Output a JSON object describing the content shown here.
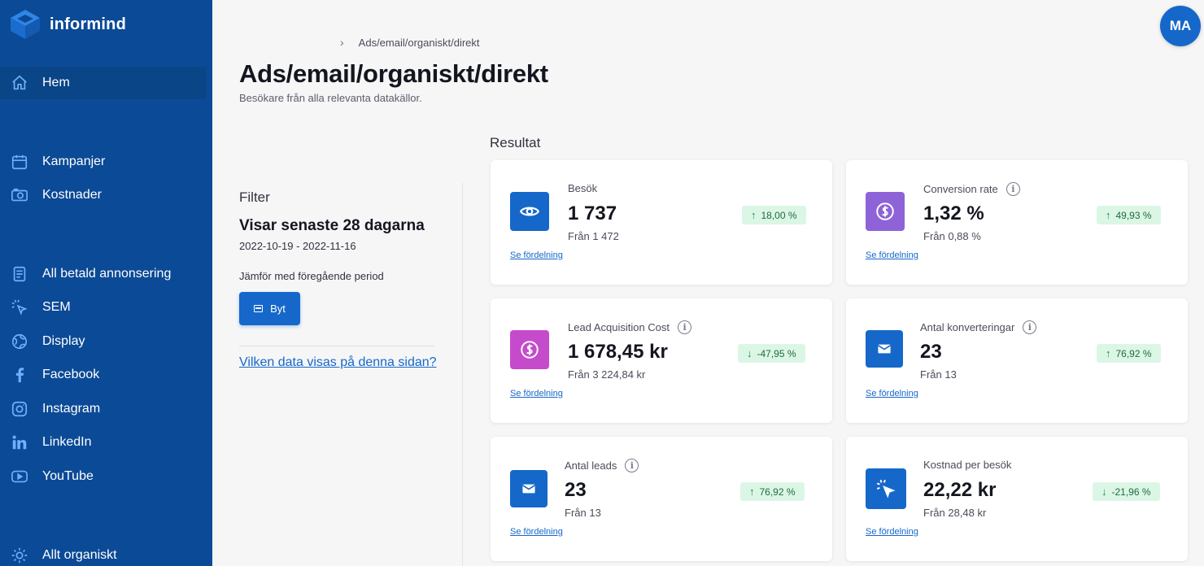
{
  "brand": {
    "name": "informind"
  },
  "colors": {
    "sidebar": "#0b4a96",
    "accent": "#1568c9",
    "badge_bg": "#dcf6e6",
    "badge_text": "#1e6b3e"
  },
  "sidebar": {
    "items": [
      {
        "label": "Hem",
        "icon": "home-icon",
        "active": true
      },
      {
        "label": "Kampanjer",
        "icon": "calendar-icon"
      },
      {
        "label": "Kostnader",
        "icon": "camera-icon"
      },
      {
        "label": "All betald annonsering",
        "icon": "document-icon"
      },
      {
        "label": "SEM",
        "icon": "cursor-click-icon"
      },
      {
        "label": "Display",
        "icon": "globe-icon"
      },
      {
        "label": "Facebook",
        "icon": "facebook-icon"
      },
      {
        "label": "Instagram",
        "icon": "instagram-icon"
      },
      {
        "label": "LinkedIn",
        "icon": "linkedin-icon"
      },
      {
        "label": "YouTube",
        "icon": "youtube-icon"
      },
      {
        "label": "Allt organiskt",
        "icon": "sun-icon"
      }
    ]
  },
  "user": {
    "initials": "MA"
  },
  "header": {
    "breadcrumb": "Ads/email/organiskt/direkt",
    "title": "Ads/email/organiskt/direkt",
    "subtitle": "Besökare från alla relevanta datakällor."
  },
  "filter": {
    "heading": "Filter",
    "range_title": "Visar senaste 28 dagarna",
    "dates": "2022-10-19 - 2022-11-16",
    "compare_label": "Jämför med föregående period",
    "button_label": "Byt",
    "link": "Vilken data visas på denna sidan?"
  },
  "results": {
    "heading": "Resultat",
    "link_label": "Se fördelning",
    "cards": [
      {
        "label": "Besök",
        "value": "1 737",
        "prev": "Från 1 472",
        "change": "18,00 %",
        "direction": "up",
        "icon": "eye-icon",
        "icon_color": "#1568c9",
        "info": false
      },
      {
        "label": "Conversion rate",
        "value": "1,32 %",
        "prev": "Från 0,88 %",
        "change": "49,93 %",
        "direction": "up",
        "icon": "dollar-icon",
        "icon_color": "#8e63d8",
        "info": true
      },
      {
        "label": "Lead Acquisition Cost",
        "value": "1 678,45 kr",
        "prev": "Från 3 224,84 kr",
        "change": "-47,95 %",
        "direction": "down",
        "icon": "dollar-icon",
        "icon_color": "#c64bcc",
        "info": true
      },
      {
        "label": "Antal konverteringar",
        "value": "23",
        "prev": "Från 13",
        "change": "76,92 %",
        "direction": "up",
        "icon": "envelope-icon",
        "icon_color": "#1568c9",
        "info": true
      },
      {
        "label": "Antal leads",
        "value": "23",
        "prev": "Från 13",
        "change": "76,92 %",
        "direction": "up",
        "icon": "envelope-icon",
        "icon_color": "#1568c9",
        "info": true
      },
      {
        "label": "Kostnad per besök",
        "value": "22,22 kr",
        "prev": "Från 28,48 kr",
        "change": "-21,96 %",
        "direction": "down",
        "icon": "cursor-click-icon",
        "icon_color": "#1568c9",
        "info": false
      }
    ]
  }
}
